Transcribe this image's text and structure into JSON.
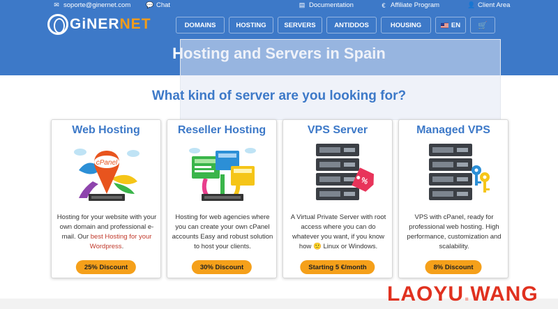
{
  "utility": {
    "email": "soporte@ginernet.com",
    "chat": "Chat",
    "documentation": "Documentation",
    "affiliate": "Affiliate Program",
    "client_area": "Client Area"
  },
  "brand": {
    "logo_prefix": "GiNER",
    "logo_suffix": "NET"
  },
  "nav": {
    "items": [
      "DOMAINS",
      "HOSTING",
      "SERVERS",
      "ANTIDDOS",
      "HOUSING"
    ],
    "language": "EN"
  },
  "hero": {
    "title": "Hosting and Servers in Spain"
  },
  "section": {
    "subtitle": "What kind of server are you looking for?"
  },
  "cards": [
    {
      "title": "Web Hosting",
      "desc_before": "Hosting for your website with your own domain and professional e-mail. Our ",
      "desc_link": "best Hosting for your Wordpress",
      "desc_after": ".",
      "badge": "25% Discount",
      "art_label": "cPanel"
    },
    {
      "title": "Reseller Hosting",
      "description": "Hosting for web agencies where you can create your own cPanel accounts Easy and robust solution to host your clients.",
      "badge": "30% Discount"
    },
    {
      "title": "VPS Server",
      "desc_before": "A Virtual Private Server with root access where you can do whatever you want, if you know how ",
      "desc_emoji": "🙂",
      "desc_after": " Linux or Windows.",
      "badge": "Starting 5 €/month",
      "tag_symbol": "%"
    },
    {
      "title": "Managed VPS",
      "description": "VPS with cPanel, ready for professional web hosting. High performance, customization and scalability.",
      "badge": "8% Discount"
    }
  ],
  "watermark": {
    "dark": "LAOYU",
    "light": ".",
    "dark2": "WANG"
  },
  "colors": {
    "header_blue": "#3d79c8",
    "accent_orange": "#f5a01a",
    "link_red": "#c0392b"
  }
}
